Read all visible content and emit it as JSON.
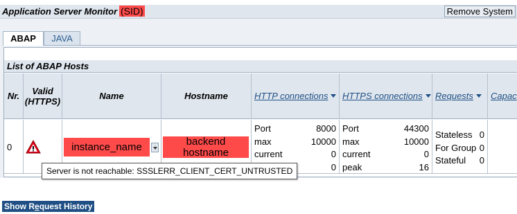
{
  "header": {
    "title": "Application Server Monitor",
    "sid": "(SID)",
    "remove_label": "Remove System"
  },
  "tabs": [
    {
      "label": "ABAP",
      "active": true
    },
    {
      "label": "JAVA",
      "active": false
    }
  ],
  "grid": {
    "title": "List of ABAP Hosts",
    "columns": {
      "nr": "Nr.",
      "valid": "Valid (HTTPS)",
      "name": "Name",
      "hostname": "Hostname",
      "http": "HTTP connections",
      "https": "HTTPS connections",
      "requests": "Requests",
      "capacity": "Capac"
    },
    "row": {
      "nr": "0",
      "name": "instance_name",
      "hostname_line1": "backend",
      "hostname_line2": "hostname",
      "http": {
        "port_label": "Port",
        "port": "8000",
        "max_label": "max",
        "max": "10000",
        "current_label": "current",
        "current": "0",
        "peak_label": "peak",
        "peak": "0"
      },
      "https": {
        "port_label": "Port",
        "port": "44300",
        "max_label": "max",
        "max": "10000",
        "current_label": "current",
        "current": "0",
        "peak_label": "peak",
        "peak": "16"
      },
      "requests": {
        "stateless_label": "Stateless",
        "stateless": "0",
        "group_label": "For Group",
        "group": "0",
        "stateful_label": "Stateful",
        "stateful": "0"
      }
    }
  },
  "tooltip": "Server is not reachable: SSSLERR_CLIENT_CERT_UNTRUSTED",
  "request_history": {
    "prefix": "Show R",
    "underlined": "e",
    "suffix": "quest History"
  },
  "icons": {
    "warning": "warning-triangle-icon",
    "sort": "sort-descending-icon",
    "dropdown": "chevron-down-icon"
  },
  "colors": {
    "highlight": "#ff4a4a",
    "header_bg": "#dfe6ee",
    "link": "#1f4f84"
  }
}
